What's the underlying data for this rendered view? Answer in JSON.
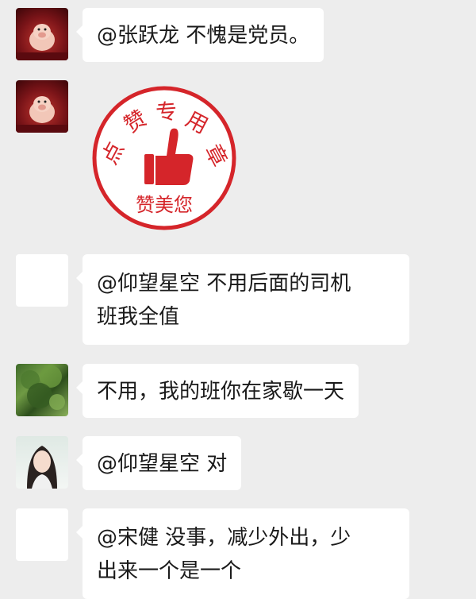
{
  "messages": [
    {
      "avatar": "pig-avatar",
      "text": "@张跃龙  不愧是党员。"
    },
    {
      "avatar": "pig-avatar",
      "sticker": {
        "arc_chars": [
          "点",
          "赞",
          "专",
          "用",
          "章"
        ],
        "bottom_text": "赞美您"
      }
    },
    {
      "avatar": "blank-avatar",
      "text_line1": "@仰望星空  不用后面的司机",
      "text_line2": "班我全值"
    },
    {
      "avatar": "tree-avatar",
      "text": "不用，我的班你在家歇一天"
    },
    {
      "avatar": "girl-avatar",
      "text": "@仰望星空 对"
    },
    {
      "avatar": "blank-avatar",
      "text_line1": "@宋健  没事，减少外出，少",
      "text_line2": "出来一个是一个"
    }
  ],
  "colors": {
    "background": "#ededed",
    "bubble": "#ffffff",
    "stamp_red": "#d5252a"
  }
}
